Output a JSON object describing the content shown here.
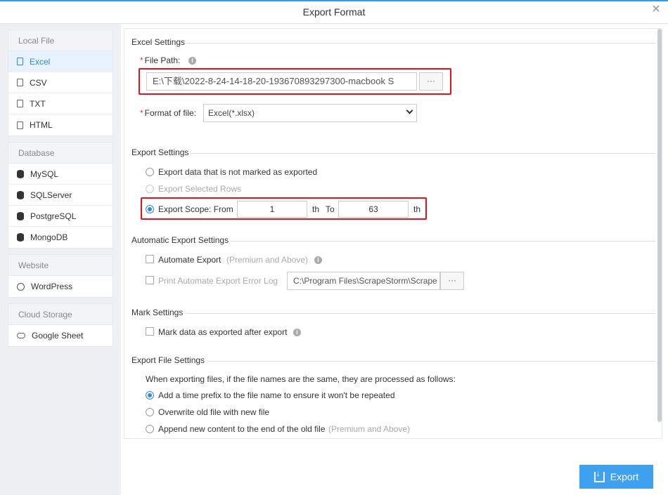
{
  "window": {
    "title": "Export Format"
  },
  "sidebar": {
    "groups": [
      {
        "header": "Local File",
        "items": [
          {
            "label": "Excel",
            "icon": "document-icon",
            "active": true
          },
          {
            "label": "CSV",
            "icon": "document-icon"
          },
          {
            "label": "TXT",
            "icon": "document-icon"
          },
          {
            "label": "HTML",
            "icon": "document-icon"
          }
        ]
      },
      {
        "header": "Database",
        "items": [
          {
            "label": "MySQL",
            "icon": "database-icon"
          },
          {
            "label": "SQLServer",
            "icon": "database-icon"
          },
          {
            "label": "PostgreSQL",
            "icon": "database-icon"
          },
          {
            "label": "MongoDB",
            "icon": "database-icon"
          }
        ]
      },
      {
        "header": "Website",
        "items": [
          {
            "label": "WordPress",
            "icon": "globe-icon"
          }
        ]
      },
      {
        "header": "Cloud Storage",
        "items": [
          {
            "label": "Google Sheet",
            "icon": "cloud-icon"
          }
        ]
      }
    ]
  },
  "excel_settings": {
    "title": "Excel Settings",
    "file_path_label": "File Path:",
    "file_path_value": "E:\\下载\\2022-8-24-14-18-20-193670893297300-macbook S",
    "browse_label": "···",
    "format_label": "Format of file:",
    "format_value": "Excel(*.xlsx)"
  },
  "export_settings": {
    "title": "Export Settings",
    "option_unmarked": "Export data that is not marked as exported",
    "option_selected": "Export Selected Rows",
    "option_scope": "Export Scope: From",
    "scope_from": "1",
    "th1": "th",
    "to_label": "To",
    "scope_to": "63",
    "th2": "th"
  },
  "automatic_export": {
    "title": "Automatic Export Settings",
    "automate_label": "Automate Export",
    "automate_note": "(Premium and Above)",
    "print_log_label": "Print Automate Export Error Log",
    "log_path": "C:\\Program Files\\ScrapeStorm\\Scrape",
    "browse_label": "···"
  },
  "mark_settings": {
    "title": "Mark Settings",
    "mark_label": "Mark data as exported after export"
  },
  "file_settings": {
    "title": "Export File Settings",
    "description": "When exporting files, if the file names are the same, they are processed as follows:",
    "option_prefix": "Add a time prefix to the file name to ensure it won't be repeated",
    "option_overwrite": "Overwrite old file with new file",
    "option_append": "Append new content to the end of the old file",
    "append_note": "(Premium and Above)"
  },
  "footer": {
    "export_label": "Export"
  },
  "colors": {
    "accent": "#2e8ae6",
    "button": "#3ea2f0",
    "highlight": "#e3131a"
  }
}
